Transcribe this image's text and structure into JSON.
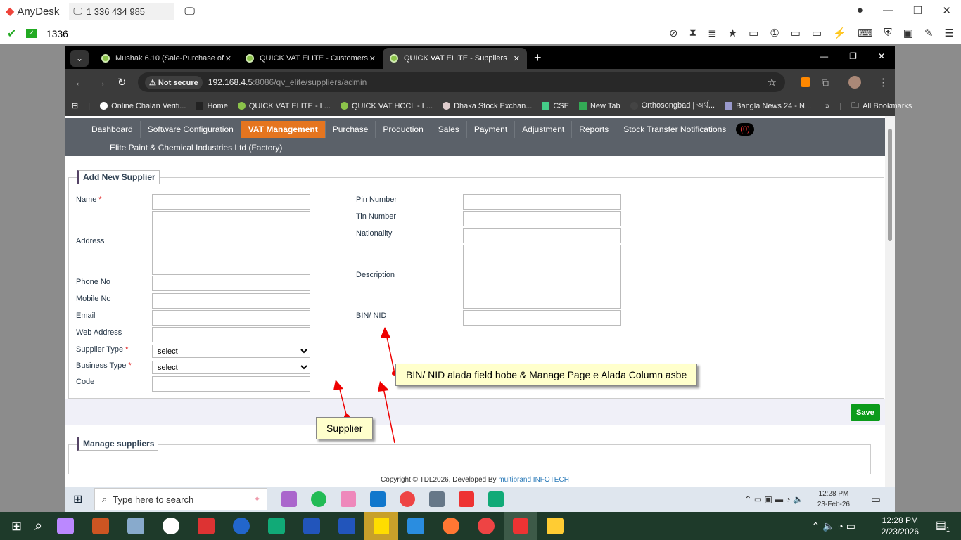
{
  "anydesk": {
    "app_name": "AnyDesk",
    "address": "1 336 434 985",
    "session_tab": "1336"
  },
  "browser": {
    "tabs": [
      {
        "label": "Mushak 6.10 (Sale-Purchase of"
      },
      {
        "label": "QUICK VAT ELITE - Customers"
      },
      {
        "label": "QUICK VAT ELITE - Suppliers",
        "active": true
      }
    ],
    "not_secure": "Not secure",
    "url_host": "192.168.4.5",
    "url_rest": ":8086/qv_elite/suppliers/admin",
    "bookmarks": [
      "Online Chalan Verifi...",
      "Home",
      "QUICK VAT ELITE - L...",
      "QUICK VAT HCCL - L...",
      "Dhaka Stock Exchan...",
      "CSE",
      "New Tab",
      "Orthosongbad | অর্থ...",
      "Bangla News 24 - N..."
    ],
    "more": "»",
    "all_bookmarks": "All Bookmarks"
  },
  "nav": {
    "items": [
      "Dashboard",
      "Software Configuration",
      "VAT Management",
      "Purchase",
      "Production",
      "Sales",
      "Payment",
      "Adjustment",
      "Reports",
      "Stock Transfer Notifications"
    ],
    "active": "VAT Management",
    "notification_count": "(0)",
    "company": "Elite Paint & Chemical Industries Ltd (Factory)"
  },
  "form": {
    "title": "Add New Supplier",
    "left": {
      "name": "Name",
      "address": "Address",
      "phone": "Phone No",
      "mobile": "Mobile No",
      "email": "Email",
      "web": "Web Address",
      "supplier_type": "Supplier Type",
      "business_type": "Business Type",
      "code": "Code",
      "select": "select",
      "required": "*"
    },
    "right": {
      "pin": "Pin Number",
      "tin": "Tin Number",
      "nationality": "Nationality",
      "description": "Description",
      "bin": "BIN/ NID"
    },
    "save": "Save"
  },
  "annotations": {
    "bin_note": "BIN/ NID alada field hobe & Manage Page e Alada Column asbe",
    "supplier_note": "Supplier"
  },
  "manage": {
    "title": "Manage suppliers"
  },
  "footer": {
    "text": "Copyright © TDL2026, Developed By ",
    "link": "multibrand INFOTECH"
  },
  "inner_taskbar": {
    "search_placeholder": "Type here to search",
    "time": "12:28 PM",
    "date": "23-Feb-26"
  },
  "outer_taskbar": {
    "time": "12:28 PM",
    "date": "2/23/2026",
    "notifications": "1"
  }
}
